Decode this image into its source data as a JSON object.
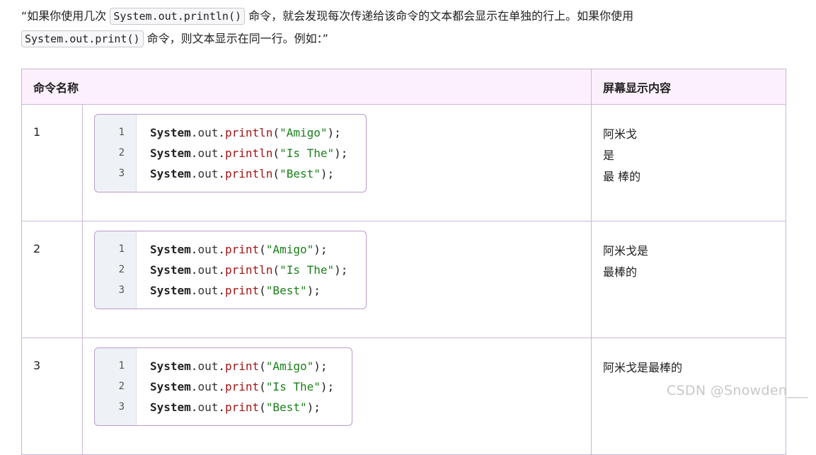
{
  "intro": {
    "p1": "“如果你使用几次 ",
    "code1": "System.out.println()",
    "p2": " 命令，就会发现每次传递给该命令的文本都会显示在单独的行上。如果你使用",
    "code2": "System.out.print()",
    "p3": " 命令，则文本显示在同一行。例如：”"
  },
  "table": {
    "headers": [
      "命令名称",
      "屏幕显示内容"
    ],
    "rows": [
      {
        "num": "1",
        "code": [
          {
            "ln": "1",
            "cls": "System",
            "dot1": ".",
            "obj": "out",
            "dot2": ".",
            "method": "println",
            "open": "(",
            "str": "\"Amigo\"",
            "close": ");"
          },
          {
            "ln": "2",
            "cls": "System",
            "dot1": ".",
            "obj": "out",
            "dot2": ".",
            "method": "println",
            "open": "(",
            "str": "\"Is The\"",
            "close": ");"
          },
          {
            "ln": "3",
            "cls": "System",
            "dot1": ".",
            "obj": "out",
            "dot2": ".",
            "method": "println",
            "open": "(",
            "str": "\"Best\"",
            "close": ");"
          }
        ],
        "output": [
          "阿米戈",
          "是",
          "最 棒的"
        ]
      },
      {
        "num": "2",
        "code": [
          {
            "ln": "1",
            "cls": "System",
            "dot1": ".",
            "obj": "out",
            "dot2": ".",
            "method": "print",
            "open": "(",
            "str": "\"Amigo\"",
            "close": ");"
          },
          {
            "ln": "2",
            "cls": "System",
            "dot1": ".",
            "obj": "out",
            "dot2": ".",
            "method": "println",
            "open": "(",
            "str": "\"Is The\"",
            "close": ");"
          },
          {
            "ln": "3",
            "cls": "System",
            "dot1": ".",
            "obj": "out",
            "dot2": ".",
            "method": "print",
            "open": "(",
            "str": "\"Best\"",
            "close": ");"
          }
        ],
        "output": [
          "阿米戈是",
          "最棒的"
        ]
      },
      {
        "num": "3",
        "code": [
          {
            "ln": "1",
            "cls": "System",
            "dot1": ".",
            "obj": "out",
            "dot2": ".",
            "method": "print",
            "open": "(",
            "str": "\"Amigo\"",
            "close": ");"
          },
          {
            "ln": "2",
            "cls": "System",
            "dot1": ".",
            "obj": "out",
            "dot2": ".",
            "method": "print",
            "open": "(",
            "str": "\"Is The\"",
            "close": ");"
          },
          {
            "ln": "3",
            "cls": "System",
            "dot1": ".",
            "obj": "out",
            "dot2": ".",
            "method": "print",
            "open": "(",
            "str": "\"Best\"",
            "close": ");"
          }
        ],
        "output": [
          "阿米戈是最棒的"
        ]
      }
    ]
  },
  "watermark": "CSDN @Snowden___"
}
